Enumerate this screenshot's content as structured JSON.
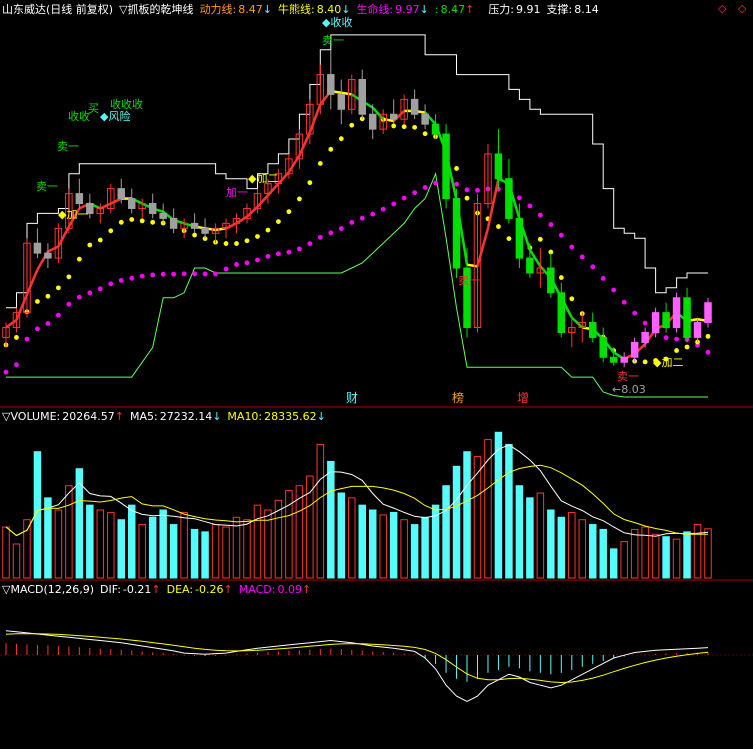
{
  "colors": {
    "bg": "#000000",
    "red": "#ff3232",
    "cyan": "#54fcfc",
    "white": "#ffffff",
    "yellow": "#ffff00",
    "magenta": "#ff00ff",
    "green": "#00e000",
    "gray": "#a0a0a0",
    "pink": "#ff60ff",
    "orange": "#ffa000",
    "divider": "#b00000",
    "support_line": "#60ff60"
  },
  "header": {
    "stock": "山东威达(日线 前复权)",
    "indicator_marker": "▽",
    "indicator": "抓板的乾坤线",
    "power_label": "动力线:",
    "power_value": "8.47",
    "power_arrow": "↓",
    "bull_label": "牛熊线:",
    "bull_value": "8.40",
    "bull_arrow": "↓",
    "life_label": "生命线:",
    "life_value": "9.97",
    "life_arrow": "↓",
    "extra_label": ":",
    "extra_value": "8.47",
    "extra_arrow": "↑",
    "pressure_label": "压力:",
    "pressure_value": "9.91",
    "support_label": "支撑:",
    "support_value": "8.14",
    "corner_icon_1": "◇",
    "corner_icon_2": "◇"
  },
  "volume_header": {
    "marker": "▽",
    "vol_label": "VOLUME:",
    "vol_value": "20264.57",
    "vol_arrow": "↑",
    "ma5_label": "MA5:",
    "ma5_value": "27232.14",
    "ma5_arrow": "↓",
    "ma10_label": "MA10:",
    "ma10_value": "28335.62",
    "ma10_arrow": "↓"
  },
  "macd_header": {
    "marker": "▽",
    "title": "MACD(12,26,9)",
    "dif_label": "DIF:",
    "dif_value": "-0.21",
    "dif_arrow": "↑",
    "dea_label": "DEA:",
    "dea_value": "-0.26",
    "dea_arrow": "↑",
    "macd_label": "MACD:",
    "macd_value": "0.09",
    "macd_arrow": "↑"
  },
  "annotations": {
    "sell": "卖一",
    "add_one": "加一",
    "add_two": "加二",
    "buy": "买",
    "shou": "收收收",
    "shou2": "收收",
    "risk": "风险",
    "low_price": "8.03",
    "event_cai": "财",
    "event_bang": "榜",
    "event_zeng": "增"
  },
  "chart_data": {
    "type": "candlestick",
    "candles": [
      {
        "o": 8.6,
        "h": 8.9,
        "l": 8.4,
        "c": 8.8
      },
      {
        "o": 8.8,
        "h": 9.2,
        "l": 8.7,
        "c": 9.1
      },
      {
        "o": 9.1,
        "h": 10.6,
        "l": 9.0,
        "c": 10.5
      },
      {
        "o": 10.5,
        "h": 10.8,
        "l": 10.2,
        "c": 10.3
      },
      {
        "o": 10.3,
        "h": 10.5,
        "l": 10.0,
        "c": 10.2
      },
      {
        "o": 10.2,
        "h": 10.9,
        "l": 10.1,
        "c": 10.8
      },
      {
        "o": 10.8,
        "h": 11.6,
        "l": 10.7,
        "c": 11.5
      },
      {
        "o": 11.5,
        "h": 11.8,
        "l": 11.2,
        "c": 11.3
      },
      {
        "o": 11.3,
        "h": 11.5,
        "l": 11.0,
        "c": 11.1
      },
      {
        "o": 11.1,
        "h": 11.3,
        "l": 10.9,
        "c": 11.2
      },
      {
        "o": 11.2,
        "h": 11.7,
        "l": 11.1,
        "c": 11.6
      },
      {
        "o": 11.6,
        "h": 11.8,
        "l": 11.3,
        "c": 11.4
      },
      {
        "o": 11.4,
        "h": 11.6,
        "l": 11.1,
        "c": 11.2
      },
      {
        "o": 11.2,
        "h": 11.4,
        "l": 11.0,
        "c": 11.3
      },
      {
        "o": 11.3,
        "h": 11.5,
        "l": 11.0,
        "c": 11.1
      },
      {
        "o": 11.1,
        "h": 11.3,
        "l": 10.9,
        "c": 11.0
      },
      {
        "o": 11.0,
        "h": 11.2,
        "l": 10.7,
        "c": 10.8
      },
      {
        "o": 10.8,
        "h": 11.0,
        "l": 10.6,
        "c": 10.9
      },
      {
        "o": 10.9,
        "h": 11.1,
        "l": 10.7,
        "c": 10.8
      },
      {
        "o": 10.8,
        "h": 11.0,
        "l": 10.6,
        "c": 10.7
      },
      {
        "o": 10.7,
        "h": 10.9,
        "l": 10.5,
        "c": 10.8
      },
      {
        "o": 10.8,
        "h": 11.0,
        "l": 10.6,
        "c": 10.9
      },
      {
        "o": 10.9,
        "h": 11.1,
        "l": 10.7,
        "c": 11.0
      },
      {
        "o": 11.0,
        "h": 11.3,
        "l": 10.9,
        "c": 11.2
      },
      {
        "o": 11.2,
        "h": 11.6,
        "l": 11.1,
        "c": 11.5
      },
      {
        "o": 11.5,
        "h": 11.8,
        "l": 11.3,
        "c": 11.7
      },
      {
        "o": 11.7,
        "h": 12.0,
        "l": 11.5,
        "c": 11.9
      },
      {
        "o": 11.9,
        "h": 12.3,
        "l": 11.8,
        "c": 12.2
      },
      {
        "o": 12.2,
        "h": 12.8,
        "l": 12.0,
        "c": 12.7
      },
      {
        "o": 12.7,
        "h": 13.4,
        "l": 12.5,
        "c": 13.3
      },
      {
        "o": 13.3,
        "h": 14.1,
        "l": 13.1,
        "c": 13.9
      },
      {
        "o": 13.9,
        "h": 14.4,
        "l": 13.2,
        "c": 13.5
      },
      {
        "o": 13.5,
        "h": 13.8,
        "l": 12.9,
        "c": 13.2
      },
      {
        "o": 13.2,
        "h": 13.9,
        "l": 13.1,
        "c": 13.8
      },
      {
        "o": 13.8,
        "h": 14.0,
        "l": 13.0,
        "c": 13.1
      },
      {
        "o": 13.1,
        "h": 13.3,
        "l": 12.6,
        "c": 12.8
      },
      {
        "o": 12.8,
        "h": 13.2,
        "l": 12.7,
        "c": 13.1
      },
      {
        "o": 13.1,
        "h": 13.4,
        "l": 12.9,
        "c": 13.0
      },
      {
        "o": 13.0,
        "h": 13.5,
        "l": 12.9,
        "c": 13.4
      },
      {
        "o": 13.4,
        "h": 13.6,
        "l": 13.0,
        "c": 13.1
      },
      {
        "o": 13.1,
        "h": 13.3,
        "l": 12.8,
        "c": 12.9
      },
      {
        "o": 12.9,
        "h": 13.1,
        "l": 12.6,
        "c": 12.7
      },
      {
        "o": 12.7,
        "h": 12.9,
        "l": 11.2,
        "c": 11.4
      },
      {
        "o": 11.4,
        "h": 11.6,
        "l": 9.8,
        "c": 10.0
      },
      {
        "o": 10.0,
        "h": 10.4,
        "l": 8.6,
        "c": 8.8
      },
      {
        "o": 8.8,
        "h": 11.5,
        "l": 8.7,
        "c": 11.3
      },
      {
        "o": 11.3,
        "h": 12.5,
        "l": 11.2,
        "c": 12.3
      },
      {
        "o": 12.3,
        "h": 12.8,
        "l": 11.6,
        "c": 11.8
      },
      {
        "o": 11.8,
        "h": 12.2,
        "l": 10.9,
        "c": 11.0
      },
      {
        "o": 11.0,
        "h": 11.3,
        "l": 10.0,
        "c": 10.2
      },
      {
        "o": 10.2,
        "h": 10.5,
        "l": 9.8,
        "c": 9.9
      },
      {
        "o": 9.9,
        "h": 10.4,
        "l": 9.6,
        "c": 10.0
      },
      {
        "o": 10.0,
        "h": 10.3,
        "l": 9.4,
        "c": 9.5
      },
      {
        "o": 9.5,
        "h": 9.7,
        "l": 8.6,
        "c": 8.7
      },
      {
        "o": 8.7,
        "h": 9.0,
        "l": 8.4,
        "c": 8.8
      },
      {
        "o": 8.8,
        "h": 9.1,
        "l": 8.5,
        "c": 8.9
      },
      {
        "o": 8.9,
        "h": 9.1,
        "l": 8.5,
        "c": 8.6
      },
      {
        "o": 8.6,
        "h": 8.8,
        "l": 8.1,
        "c": 8.2
      },
      {
        "o": 8.2,
        "h": 8.4,
        "l": 8.03,
        "c": 8.1
      },
      {
        "o": 8.1,
        "h": 8.3,
        "l": 8.0,
        "c": 8.2
      },
      {
        "o": 8.2,
        "h": 8.6,
        "l": 8.1,
        "c": 8.5
      },
      {
        "o": 8.5,
        "h": 8.8,
        "l": 8.4,
        "c": 8.7
      },
      {
        "o": 8.7,
        "h": 9.2,
        "l": 8.6,
        "c": 9.1
      },
      {
        "o": 9.1,
        "h": 9.3,
        "l": 8.7,
        "c": 8.8
      },
      {
        "o": 8.8,
        "h": 9.5,
        "l": 8.7,
        "c": 9.4
      },
      {
        "o": 9.4,
        "h": 9.6,
        "l": 8.5,
        "c": 8.6
      },
      {
        "o": 8.6,
        "h": 9.0,
        "l": 8.5,
        "c": 8.9
      },
      {
        "o": 8.9,
        "h": 9.4,
        "l": 8.8,
        "c": 9.3
      }
    ],
    "volume": [
      21000,
      14000,
      24000,
      52000,
      33000,
      28000,
      38000,
      45000,
      30000,
      28000,
      27000,
      24000,
      30000,
      22000,
      25000,
      28000,
      22000,
      27000,
      20000,
      19000,
      22000,
      21000,
      25000,
      24000,
      30000,
      28000,
      32000,
      36000,
      38000,
      42000,
      55000,
      48000,
      35000,
      33000,
      30000,
      28000,
      26000,
      27000,
      24000,
      22000,
      25000,
      30000,
      38000,
      46000,
      52000,
      50000,
      57000,
      60000,
      55000,
      38000,
      33000,
      35000,
      28000,
      25000,
      27000,
      24000,
      22000,
      20000,
      12000,
      15000,
      20000,
      21000,
      18000,
      17000,
      16000,
      19000,
      22000,
      20264
    ],
    "macd": [
      0.4,
      0.38,
      0.36,
      0.34,
      0.32,
      0.3,
      0.28,
      0.26,
      0.24,
      0.22,
      0.2,
      0.18,
      0.15,
      0.12,
      0.09,
      0.06,
      0.03,
      -0.01,
      -0.02,
      -0.03,
      -0.02,
      -0.01,
      0.02,
      0.05,
      0.08,
      0.1,
      0.12,
      0.14,
      0.16,
      0.18,
      0.2,
      0.22,
      0.2,
      0.18,
      0.15,
      0.12,
      0.1,
      0.08,
      0.05,
      0.02,
      -0.1,
      -0.3,
      -0.6,
      -0.8,
      -0.9,
      -0.8,
      -0.6,
      -0.5,
      -0.4,
      -0.45,
      -0.55,
      -0.6,
      -0.65,
      -0.6,
      -0.5,
      -0.4,
      -0.3,
      -0.2,
      -0.1,
      -0.05,
      0.0,
      0.02,
      0.04,
      0.05,
      0.06,
      0.07,
      0.08,
      0.09
    ],
    "price_range": [
      7.5,
      15.0
    ]
  }
}
